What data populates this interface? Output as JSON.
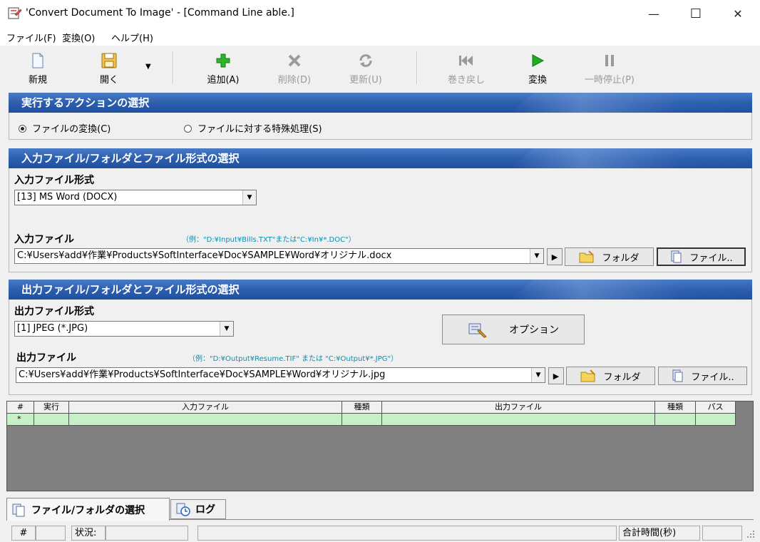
{
  "window": {
    "title": "'Convert Document To Image' - [Command Line able.]",
    "minimize": "—",
    "maximize": "☐",
    "close": "✕"
  },
  "menu": [
    "ファイル(F)",
    "変換(O)",
    "ヘルプ(H)"
  ],
  "toolbar": {
    "new": "新規",
    "open": "開く",
    "add": "追加(A)",
    "delete": "削除(D)",
    "update": "更新(U)",
    "rewind": "巻き戻し",
    "convert": "変換",
    "pause": "一時停止(P)"
  },
  "action_section": {
    "title": "実行するアクションの選択",
    "options": [
      {
        "label": "ファイルの変換(C)",
        "selected": true
      },
      {
        "label": "ファイルに対する特殊処理(S)",
        "selected": false
      }
    ]
  },
  "input_section": {
    "title": "入力ファイル/フォルダとファイル形式の選択",
    "format_label": "入力ファイル形式",
    "format_value": "[13] MS Word (DOCX)",
    "file_label": "入力ファイル",
    "file_hint": "（例：\"D:¥Input¥Bills.TXT\"または\"C:¥In¥*.DOC\"）",
    "file_value": "C:¥Users¥add¥作業¥Products¥SoftInterface¥Doc¥SAMPLE¥Word¥オリジナル.docx",
    "folder_button": "フォルダ",
    "file_button": "ファイル..",
    "play_glyph": "▶"
  },
  "output_section": {
    "title": "出力ファイル/フォルダとファイル形式の選択",
    "format_label": "出力ファイル形式",
    "format_value": "[1] JPEG (*.JPG)",
    "options_button": "オプション",
    "file_label": "出力ファイル",
    "file_hint": "（例：\"D:¥Output¥Resume.TIF\" または \"C:¥Output¥*.JPG\"）",
    "file_value": "C:¥Users¥add¥作業¥Products¥SoftInterface¥Doc¥SAMPLE¥Word¥オリジナル.jpg",
    "folder_button": "フォルダ",
    "file_button": "ファイル..",
    "play_glyph": "▶"
  },
  "grid": {
    "headers": [
      "#",
      "実行",
      "入力ファイル",
      "種類",
      "出力ファイル",
      "種類",
      "パス"
    ],
    "new_row_marker": "*"
  },
  "tabs": [
    {
      "label": "ファイル/フォルダの選択",
      "active": true
    },
    {
      "label": "ログ",
      "active": false
    }
  ],
  "status": {
    "hash": "#",
    "status_label": "状況:",
    "total_time": "合計時間(秒)"
  },
  "colors": {
    "section_header": "#2e5fae",
    "grid_row": "#c8f0c8",
    "grid_background": "#808080",
    "hint_text": "#0a8fb0",
    "add_icon": "#2db52d",
    "convert_icon": "#1fae1f"
  }
}
